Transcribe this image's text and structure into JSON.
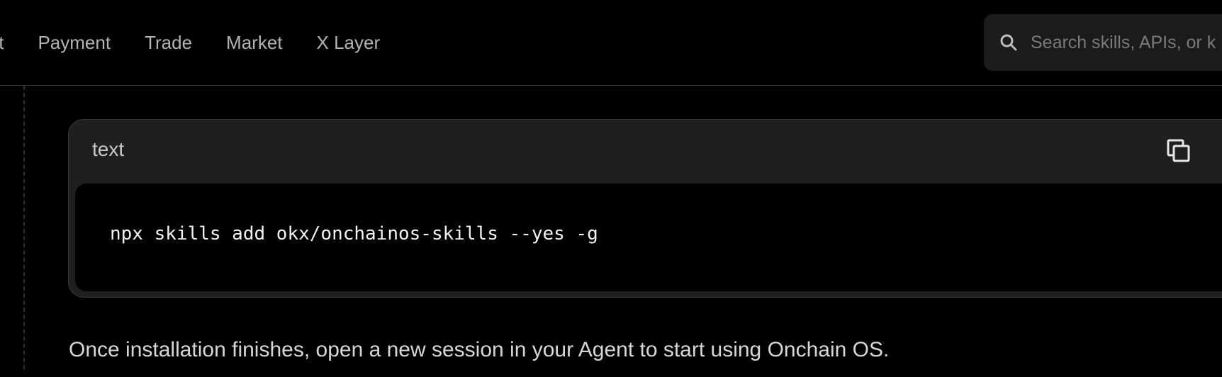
{
  "nav": {
    "items": [
      {
        "label": "let"
      },
      {
        "label": "Payment"
      },
      {
        "label": "Trade"
      },
      {
        "label": "Market"
      },
      {
        "label": "X Layer"
      }
    ]
  },
  "search": {
    "placeholder": "Search skills, APIs, or k",
    "icon": "search-icon"
  },
  "content": {
    "code_block": {
      "language": "text",
      "code": "npx skills add okx/onchainos-skills --yes -g",
      "copy_icon": "copy-icon"
    },
    "paragraph": "Once installation finishes, open a new session in your Agent to start using Onchain OS."
  },
  "colors": {
    "background": "#000000",
    "card": "#1f1f1f",
    "code_bg": "#000000",
    "nav_text": "#b3b3b3",
    "search_bg": "#1b1b1b"
  }
}
